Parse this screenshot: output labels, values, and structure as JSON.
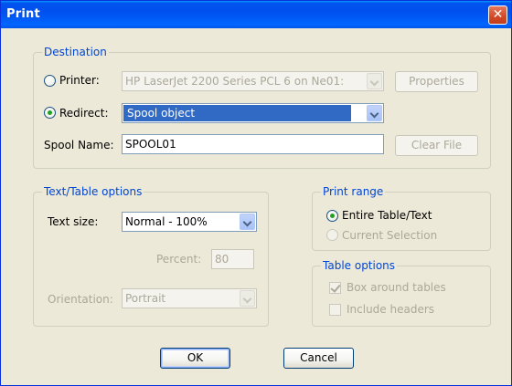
{
  "window": {
    "title": "Print",
    "close_glyph": "✕"
  },
  "destination": {
    "legend": "Destination",
    "printer_label": "Printer:",
    "printer_value": "HP LaserJet 2200 Series PCL 6 on Ne01:",
    "properties_button": "Properties",
    "redirect_label": "Redirect:",
    "redirect_value": "Spool object",
    "spool_name_label": "Spool Name:",
    "spool_name_value": "SPOOL01",
    "clear_file_button": "Clear File",
    "selected_option": "Redirect"
  },
  "text_table_options": {
    "legend": "Text/Table options",
    "text_size_label": "Text size:",
    "text_size_value": "Normal - 100%",
    "percent_label": "Percent:",
    "percent_value": "80",
    "orientation_label": "Orientation:",
    "orientation_value": "Portrait"
  },
  "print_range": {
    "legend": "Print range",
    "entire_label": "Entire Table/Text",
    "current_label": "Current Selection",
    "selected_option": "Entire Table/Text"
  },
  "table_options": {
    "legend": "Table options",
    "box_label": "Box around tables",
    "box_checked": true,
    "headers_label": "Include headers",
    "headers_checked": false
  },
  "buttons": {
    "ok": "OK",
    "cancel": "Cancel"
  },
  "colors": {
    "title_bar": "#0054e3",
    "dialog_bg": "#ece9d8",
    "legend_text": "#0046d5",
    "selection": "#316ac5"
  }
}
